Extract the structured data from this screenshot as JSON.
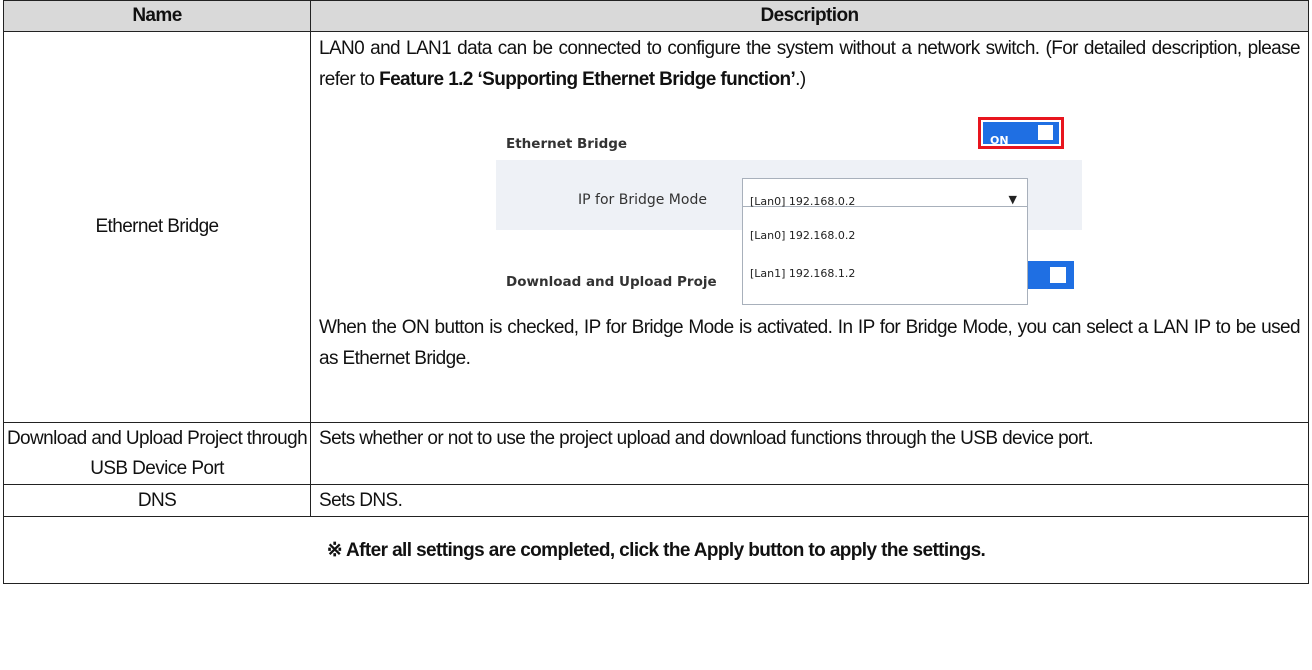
{
  "table": {
    "headers": [
      "Name",
      "Description"
    ],
    "rows": [
      {
        "name": "Ethernet Bridge",
        "desc_p1": {
          "pre": "LAN0 and LAN1 data can be connected to configure the system without a network switch. (For detailed description, please refer to ",
          "bold": "Feature 1.2 ‘Supporting Ethernet Bridge function’",
          "post": ".)"
        },
        "desc_p2": "When the ON button is checked, IP for Bridge Mode is activated. In IP for Bridge Mode, you can select a LAN IP to be used as Ethernet Bridge."
      },
      {
        "name": "Download and Upload Project through USB Device Port",
        "desc": "Sets whether or not to use the project upload and download functions through the USB device port."
      },
      {
        "name": "DNS",
        "desc": "Sets DNS."
      }
    ],
    "note": "※ After all settings are completed, click the Apply button to apply the settings."
  },
  "screenshot": {
    "ethernet_bridge_label": "Ethernet Bridge",
    "toggle_label": "ON",
    "ip_label": "IP for Bridge Mode",
    "selected": "[Lan0] 192.168.0.2",
    "options": [
      "[Lan0] 192.168.0.2",
      "[Lan1] 192.168.1.2"
    ],
    "download_label": "Download and Upload Proje",
    "colors": {
      "toggle": "#1f6fe3",
      "highlight": "#e8151e",
      "panel": "#eef1f6",
      "header": "#d9d9d9"
    },
    "icons": {
      "dropdown": "triangle-down-icon"
    }
  }
}
